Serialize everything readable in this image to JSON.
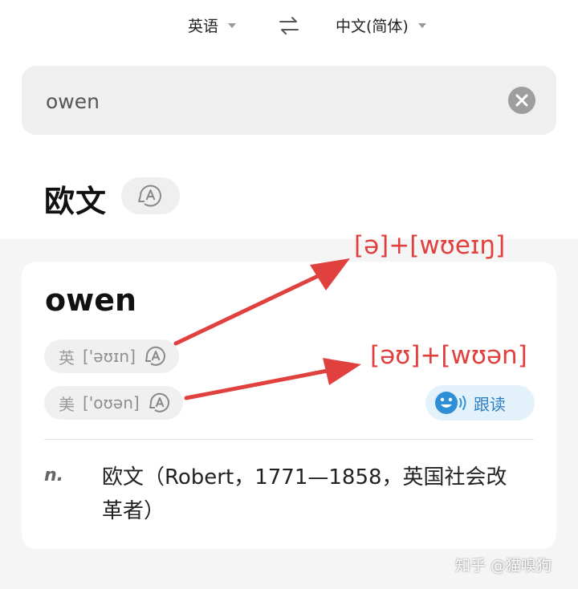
{
  "topbar": {
    "source_lang": "英语",
    "target_lang": "中文(简体)",
    "swap_icon": "swap-arrows-icon"
  },
  "search": {
    "value": "owen",
    "clear_icon": "close-circle-icon"
  },
  "entry": {
    "headword": "欧文",
    "audio_icon": "speaker-a-icon"
  },
  "card": {
    "word": "owen",
    "pronunciations": [
      {
        "region": "英",
        "ipa": "['əʊɪn]"
      },
      {
        "region": "美",
        "ipa": "['oʊən]"
      }
    ],
    "follow_read": {
      "label": "跟读",
      "icon": "smiley-speaker-icon"
    },
    "definitions": [
      {
        "pos": "n.",
        "text": "欧文（Robert，1771—1858，英国社会改革者）"
      }
    ]
  },
  "annotations": [
    {
      "text": "[ə]+[wʊeɪŋ]"
    },
    {
      "text": "[əʊ]+[wʊən]"
    }
  ],
  "colors": {
    "annotation": "#e0403e",
    "accent": "#2f7fc4",
    "pill_bg": "#f0f0f0"
  },
  "watermark": "知乎 @猫嗅狗"
}
